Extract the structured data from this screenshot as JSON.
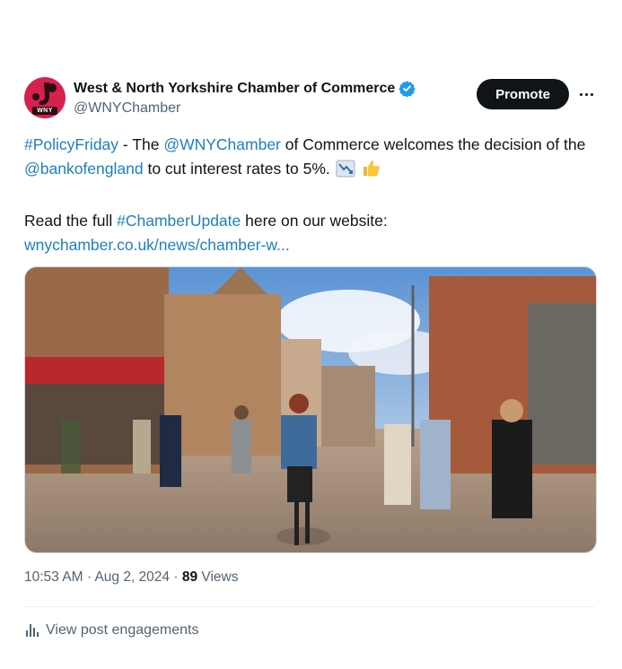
{
  "author": {
    "display_name": "West & North Yorkshire Chamber of Commerce",
    "handle": "@WNYChamber",
    "avatar_label": "WNY",
    "verified": true
  },
  "actions": {
    "promote_label": "Promote",
    "more_icon": "more-horizontal-icon"
  },
  "post": {
    "hashtag_policy": "#PolicyFriday",
    "text_1": " - The ",
    "mention_chamber": "@WNYChamber",
    "text_2": " of Commerce welcomes the decision of the ",
    "mention_boe": "@bankofengland",
    "text_3": " to cut interest rates to 5%.",
    "emoji_1": "chart-decreasing-icon",
    "emoji_2": "thumbs-up-icon",
    "line2_text": "Read the full ",
    "hashtag_update": "#ChamberUpdate",
    "line2_tail": " here on our website:",
    "url": "wnychamber.co.uk/news/chamber-w..."
  },
  "media": {
    "description_icon": "street-photo"
  },
  "meta": {
    "time": "10:53 AM",
    "separator": "·",
    "date": "Aug 2, 2024",
    "views_count": "89",
    "views_label": "Views"
  },
  "engagements": {
    "label": "View post engagements",
    "icon": "analytics-icon"
  },
  "colors": {
    "link": "#1d7fc0",
    "verified": "#1d9bf0",
    "promote_bg": "#0f1419",
    "avatar_bg": "#d6204e"
  }
}
